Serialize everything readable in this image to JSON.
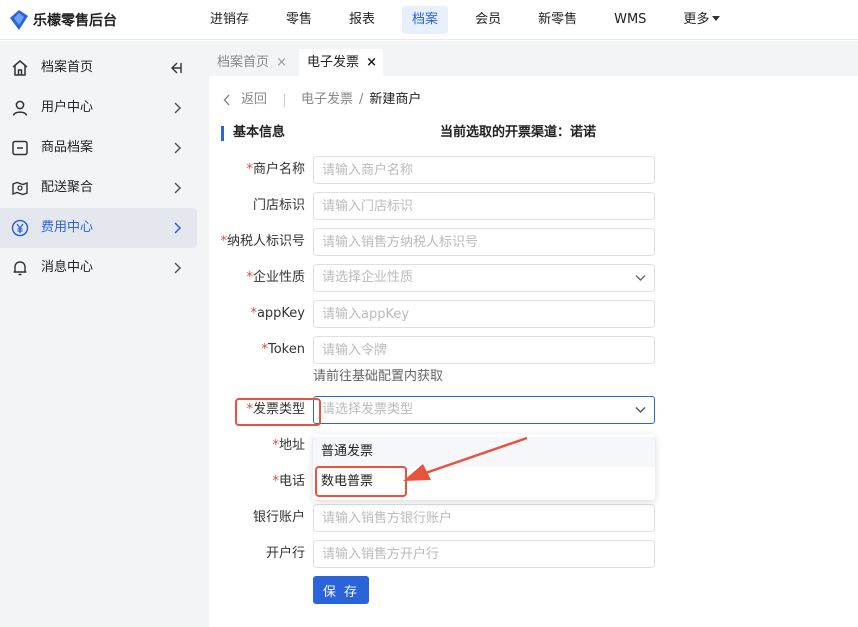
{
  "app": {
    "title": "乐檬零售后台"
  },
  "nav": {
    "items": [
      {
        "label": "进销存",
        "active": false
      },
      {
        "label": "零售",
        "active": false
      },
      {
        "label": "报表",
        "active": false
      },
      {
        "label": "档案",
        "active": true
      },
      {
        "label": "会员",
        "active": false
      },
      {
        "label": "新零售",
        "active": false
      },
      {
        "label": "WMS",
        "active": false
      },
      {
        "label": "更多",
        "active": false
      }
    ]
  },
  "sidebar": {
    "items": [
      {
        "label": "档案首页",
        "icon": "home-icon"
      },
      {
        "label": "用户中心",
        "icon": "user-icon"
      },
      {
        "label": "商品档案",
        "icon": "product-icon"
      },
      {
        "label": "配送聚合",
        "icon": "delivery-icon"
      },
      {
        "label": "费用中心",
        "icon": "yen-icon",
        "active": true
      },
      {
        "label": "消息中心",
        "icon": "bell-icon"
      }
    ]
  },
  "tabs": [
    {
      "label": "档案首页",
      "active": false,
      "close": "×"
    },
    {
      "label": "电子发票",
      "active": true,
      "close": "×"
    }
  ],
  "breadcrumb": {
    "back": "返回",
    "parent": "电子发票",
    "separator": "/",
    "current": "新建商户"
  },
  "section": {
    "title": "基本信息",
    "channel_text": "当前选取的开票渠道：诺诺"
  },
  "form": {
    "merchant_name": {
      "label": "商户名称",
      "required": true,
      "placeholder": "请输入商户名称"
    },
    "store_id": {
      "label": "门店标识",
      "required": false,
      "placeholder": "请输入门店标识"
    },
    "tax_id": {
      "label": "纳税人标识号",
      "required": true,
      "placeholder": "请输入销售方纳税人标识号"
    },
    "company_type": {
      "label": "企业性质",
      "required": true,
      "placeholder": "请选择企业性质"
    },
    "app_key": {
      "label": "appKey",
      "required": true,
      "placeholder": "请输入appKey"
    },
    "token": {
      "label": "Token",
      "required": true,
      "placeholder": "请输入令牌"
    },
    "token_hint": "请前往基础配置内获取",
    "invoice_type": {
      "label": "发票类型",
      "required": true,
      "placeholder": "请选择发票类型"
    },
    "address": {
      "label": "地址",
      "required": true
    },
    "phone": {
      "label": "电话",
      "required": true
    },
    "bank_account": {
      "label": "银行账户",
      "required": false,
      "placeholder": "请输入销售方银行账户"
    },
    "bank_name": {
      "label": "开户行",
      "required": false,
      "placeholder": "请输入销售方开户行"
    },
    "required_mark": "*"
  },
  "dropdown": {
    "options": [
      "普通发票",
      "数电普票"
    ]
  },
  "buttons": {
    "save": "保 存"
  },
  "colors": {
    "primary": "#2b63d9",
    "annotation": "#e6533f",
    "required": "#e5463d"
  }
}
